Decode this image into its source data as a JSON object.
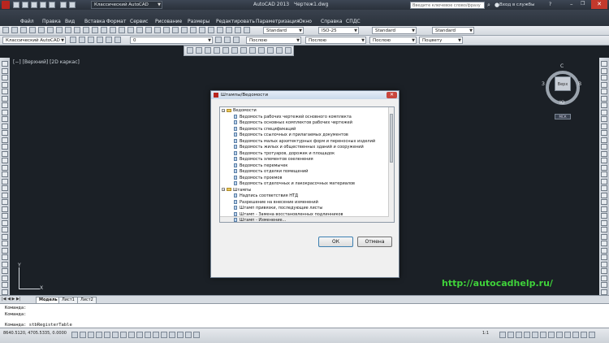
{
  "window": {
    "title_app": "AutoCAD 2013",
    "title_file": "Чертеж1.dwg",
    "workspace": "Классический AutoCAD"
  },
  "menu": [
    "Файл",
    "Правка",
    "Вид",
    "Вставка",
    "Формат",
    "Сервис",
    "Рисование",
    "Размеры",
    "Редактировать",
    "Параметризация",
    "Окно",
    "Справка",
    "СПДС"
  ],
  "search": {
    "placeholder": "Введите ключевое слово/фразу"
  },
  "signin": "Вход в службы",
  "toolbar": {
    "text_style": "Standard",
    "dim_style": "ISO-25",
    "table_style": "Standard",
    "multileader_style": "Standard",
    "workspace_combo": "Классический AutoCAD",
    "layer_combo": "0",
    "color_combo": "Послою",
    "linetype_combo": "Послою",
    "lineweight_combo": "Послою",
    "plotstyle_combo": "Поцвету"
  },
  "viewport": {
    "label": "[−] [Верхний] [2D каркас]"
  },
  "viewcube": {
    "north": "С",
    "south": "Ю",
    "west": "З",
    "east": "В",
    "face": "Верх",
    "wcs": "МСК"
  },
  "ucs": {
    "x": "X",
    "y": "Y"
  },
  "dialog": {
    "title": "Штампы/Ведомости",
    "tree": {
      "groups": [
        {
          "label": "Ведомости",
          "items": [
            "Ведомость рабочих чертежей основного комплекта",
            "Ведомость основных комплектов рабочих чертежей",
            "Ведомость спецификаций",
            "Ведомость ссылочных и прилагаемых документов",
            "Ведомость малых архитектурных форм и переносных изделий",
            "Ведомость жилых и общественных зданий и сооружений",
            "Ведомость тротуаров, дорожек и площадок",
            "Ведомость элементов озеленения",
            "Ведомость перемычек",
            "Ведомость отделки помещений",
            "Ведомость проемов",
            "Ведомость отделочных и лакокрасочных материалов"
          ]
        },
        {
          "label": "Штампы",
          "items": [
            "Надпись соответствия НТД",
            "Разрешение на внесение изменений",
            "Штамп привязки, последующие листы",
            "Штамп - Замена восстановленных подлинников",
            "Штамп - Изменение..."
          ]
        }
      ]
    },
    "ok_label": "ОК",
    "cancel_label": "Отмена"
  },
  "watermark": "http://autocadhelp.ru/",
  "layout_tabs": [
    "Модель",
    "Лист1",
    "Лист2"
  ],
  "command_lines": [
    "Команда:",
    "Команда:",
    "Команда:  stbRegisterTable"
  ],
  "status": {
    "coords": "8640.5120, 4705.5335, 0.0000",
    "scale": "1:1"
  }
}
